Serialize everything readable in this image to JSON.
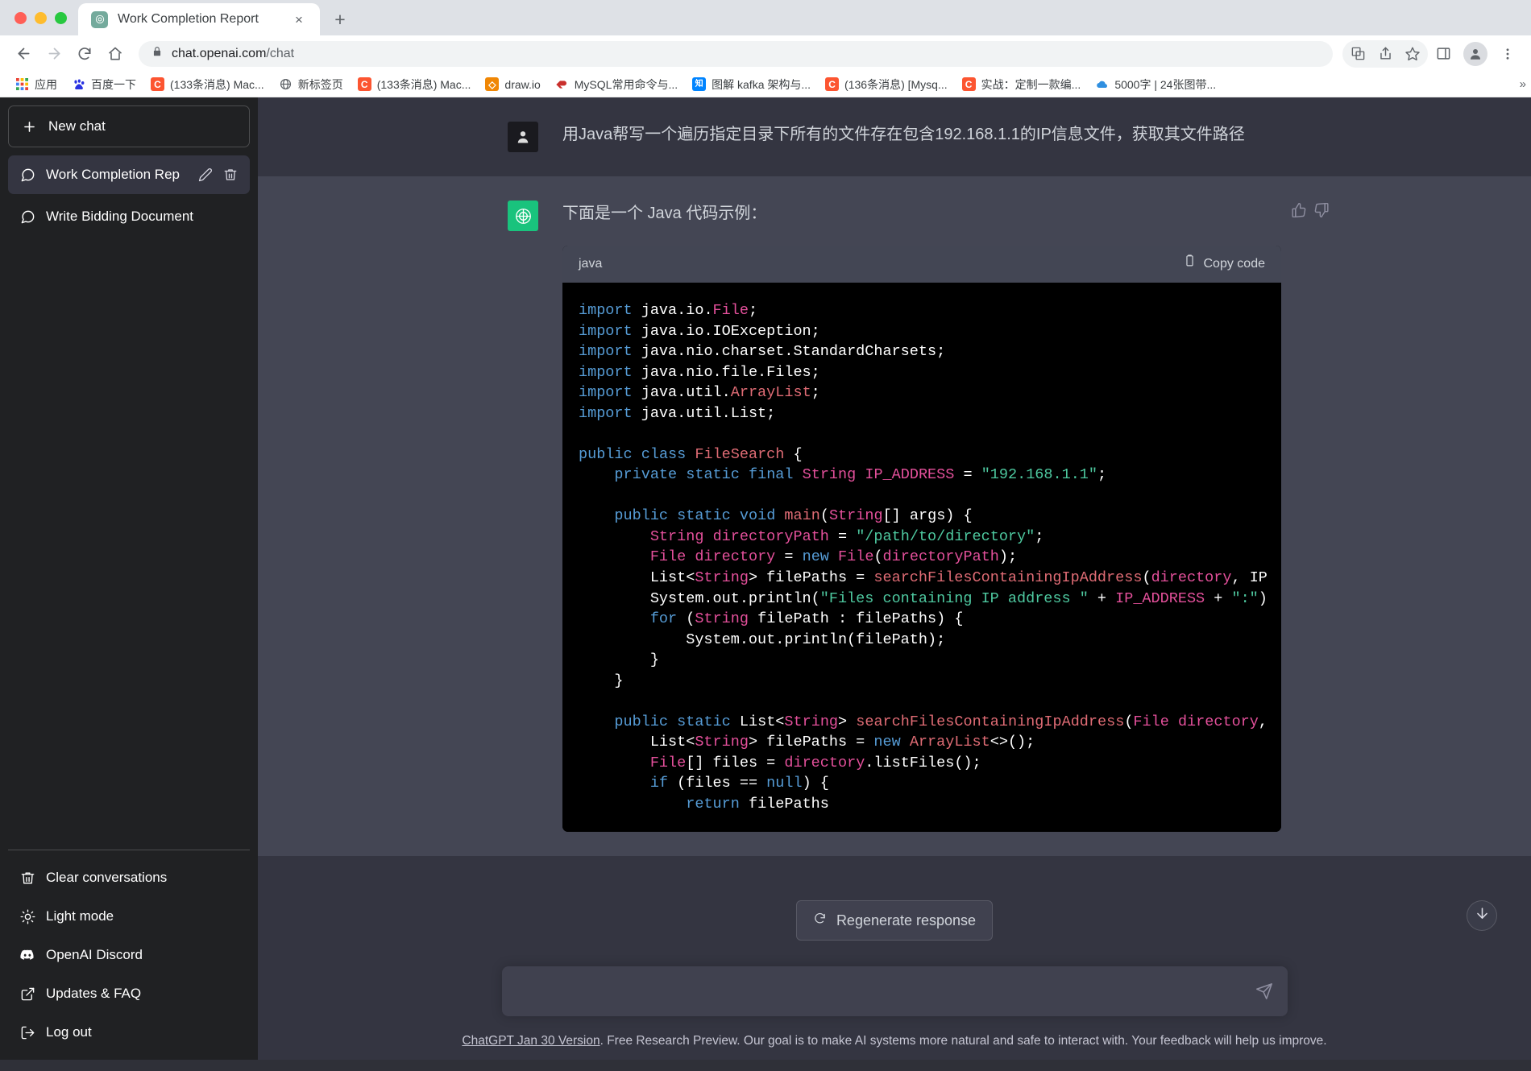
{
  "browser": {
    "tab": {
      "title": "Work Completion Report",
      "favicon": "openai-logo-icon",
      "close_label": "×"
    },
    "new_tab_label": "+",
    "toolbar": {
      "back": "back-arrow",
      "forward": "forward-arrow",
      "reload": "reload-icon",
      "home": "home-icon",
      "url_main": "chat.openai.com",
      "url_path": "/chat",
      "lock": "lock-icon",
      "translate": "translate-icon",
      "share": "share-icon",
      "bookmark": "star-icon",
      "sidepanel": "side-panel-icon",
      "profile": "profile-avatar-icon",
      "menu": "three-dot-menu-icon"
    },
    "bookmarks": [
      {
        "label": "应用",
        "icon": "apps-grid-icon",
        "color": "#4285f4"
      },
      {
        "label": "百度一下",
        "icon": "baidu-icon",
        "color": "#2932e1"
      },
      {
        "label": "(133条消息) Mac...",
        "icon": "csdn-icon",
        "color": "#fc5531"
      },
      {
        "label": "新标签页",
        "icon": "globe-icon",
        "color": "#5f6368"
      },
      {
        "label": "(133条消息) Mac...",
        "icon": "csdn-icon",
        "color": "#fc5531"
      },
      {
        "label": "draw.io",
        "icon": "drawio-icon",
        "color": "#f08705"
      },
      {
        "label": "MySQL常用命令与...",
        "icon": "mysql-icon",
        "color": "#c9302c"
      },
      {
        "label": "图解 kafka 架构与...",
        "icon": "zhihu-icon",
        "color": "#0084ff"
      },
      {
        "label": "(136条消息) [Mysq...",
        "icon": "csdn-icon",
        "color": "#fc5531"
      },
      {
        "label": "实战：定制一款编...",
        "icon": "csdn-icon",
        "color": "#fc5531"
      },
      {
        "label": "5000字 | 24张图带...",
        "icon": "cloud-icon",
        "color": "#2f8fe0"
      }
    ],
    "bookmarks_overflow": "»"
  },
  "sidebar": {
    "new_chat": {
      "label": "New chat",
      "icon": "plus-icon"
    },
    "conversations": [
      {
        "label": "Work Completion Rep",
        "icon": "chat-bubble-icon",
        "active": true,
        "edit_icon": "pencil-icon",
        "delete_icon": "trash-icon"
      },
      {
        "label": "Write Bidding Document",
        "icon": "chat-bubble-icon",
        "active": false
      }
    ],
    "bottom_items": [
      {
        "label": "Clear conversations",
        "icon": "trash-icon"
      },
      {
        "label": "Light mode",
        "icon": "sun-icon"
      },
      {
        "label": "OpenAI Discord",
        "icon": "discord-icon"
      },
      {
        "label": "Updates & FAQ",
        "icon": "external-link-icon"
      },
      {
        "label": "Log out",
        "icon": "logout-icon"
      }
    ]
  },
  "conversation": {
    "user_message": "用Java帮写一个遍历指定目录下所有的文件存在包含192.168.1.1的IP信息文件，获取其文件路径",
    "assistant_intro": "下面是一个 Java 代码示例：",
    "thumbs_up": "thumbs-up-icon",
    "thumbs_down": "thumbs-down-icon",
    "code": {
      "language": "java",
      "copy_label": "Copy code",
      "copy_icon": "clipboard-icon",
      "lines": [
        "import java.io.File;",
        "import java.io.IOException;",
        "import java.nio.charset.StandardCharsets;",
        "import java.nio.file.Files;",
        "import java.util.ArrayList;",
        "import java.util.List;",
        "",
        "public class FileSearch {",
        "    private static final String IP_ADDRESS = \"192.168.1.1\";",
        "",
        "    public static void main(String[] args) {",
        "        String directoryPath = \"/path/to/directory\";",
        "        File directory = new File(directoryPath);",
        "        List<String> filePaths = searchFilesContainingIpAddress(directory, IP",
        "        System.out.println(\"Files containing IP address \" + IP_ADDRESS + \":\")",
        "        for (String filePath : filePaths) {",
        "            System.out.println(filePath);",
        "        }",
        "    }",
        "",
        "    public static List<String> searchFilesContainingIpAddress(File directory,",
        "        List<String> filePaths = new ArrayList<>();",
        "        File[] files = directory.listFiles();",
        "        if (files == null) {",
        "            return filePaths"
      ]
    }
  },
  "regenerate": {
    "label": "Regenerate response",
    "icon": "refresh-icon"
  },
  "scroll_down_button": {
    "icon": "arrow-down-icon"
  },
  "composer": {
    "value": "",
    "placeholder": "",
    "send_icon": "send-paper-plane-icon"
  },
  "footer": {
    "link_text": "ChatGPT Jan 30 Version",
    "rest_text": ". Free Research Preview. Our goal is to make AI systems more natural and safe to interact with. Your feedback will help us improve."
  },
  "colors": {
    "sidebar_bg": "#202123",
    "chat_bg": "#343541",
    "assistant_bg": "#444654",
    "accent_green": "#19c37d",
    "code_bg": "#000000"
  }
}
